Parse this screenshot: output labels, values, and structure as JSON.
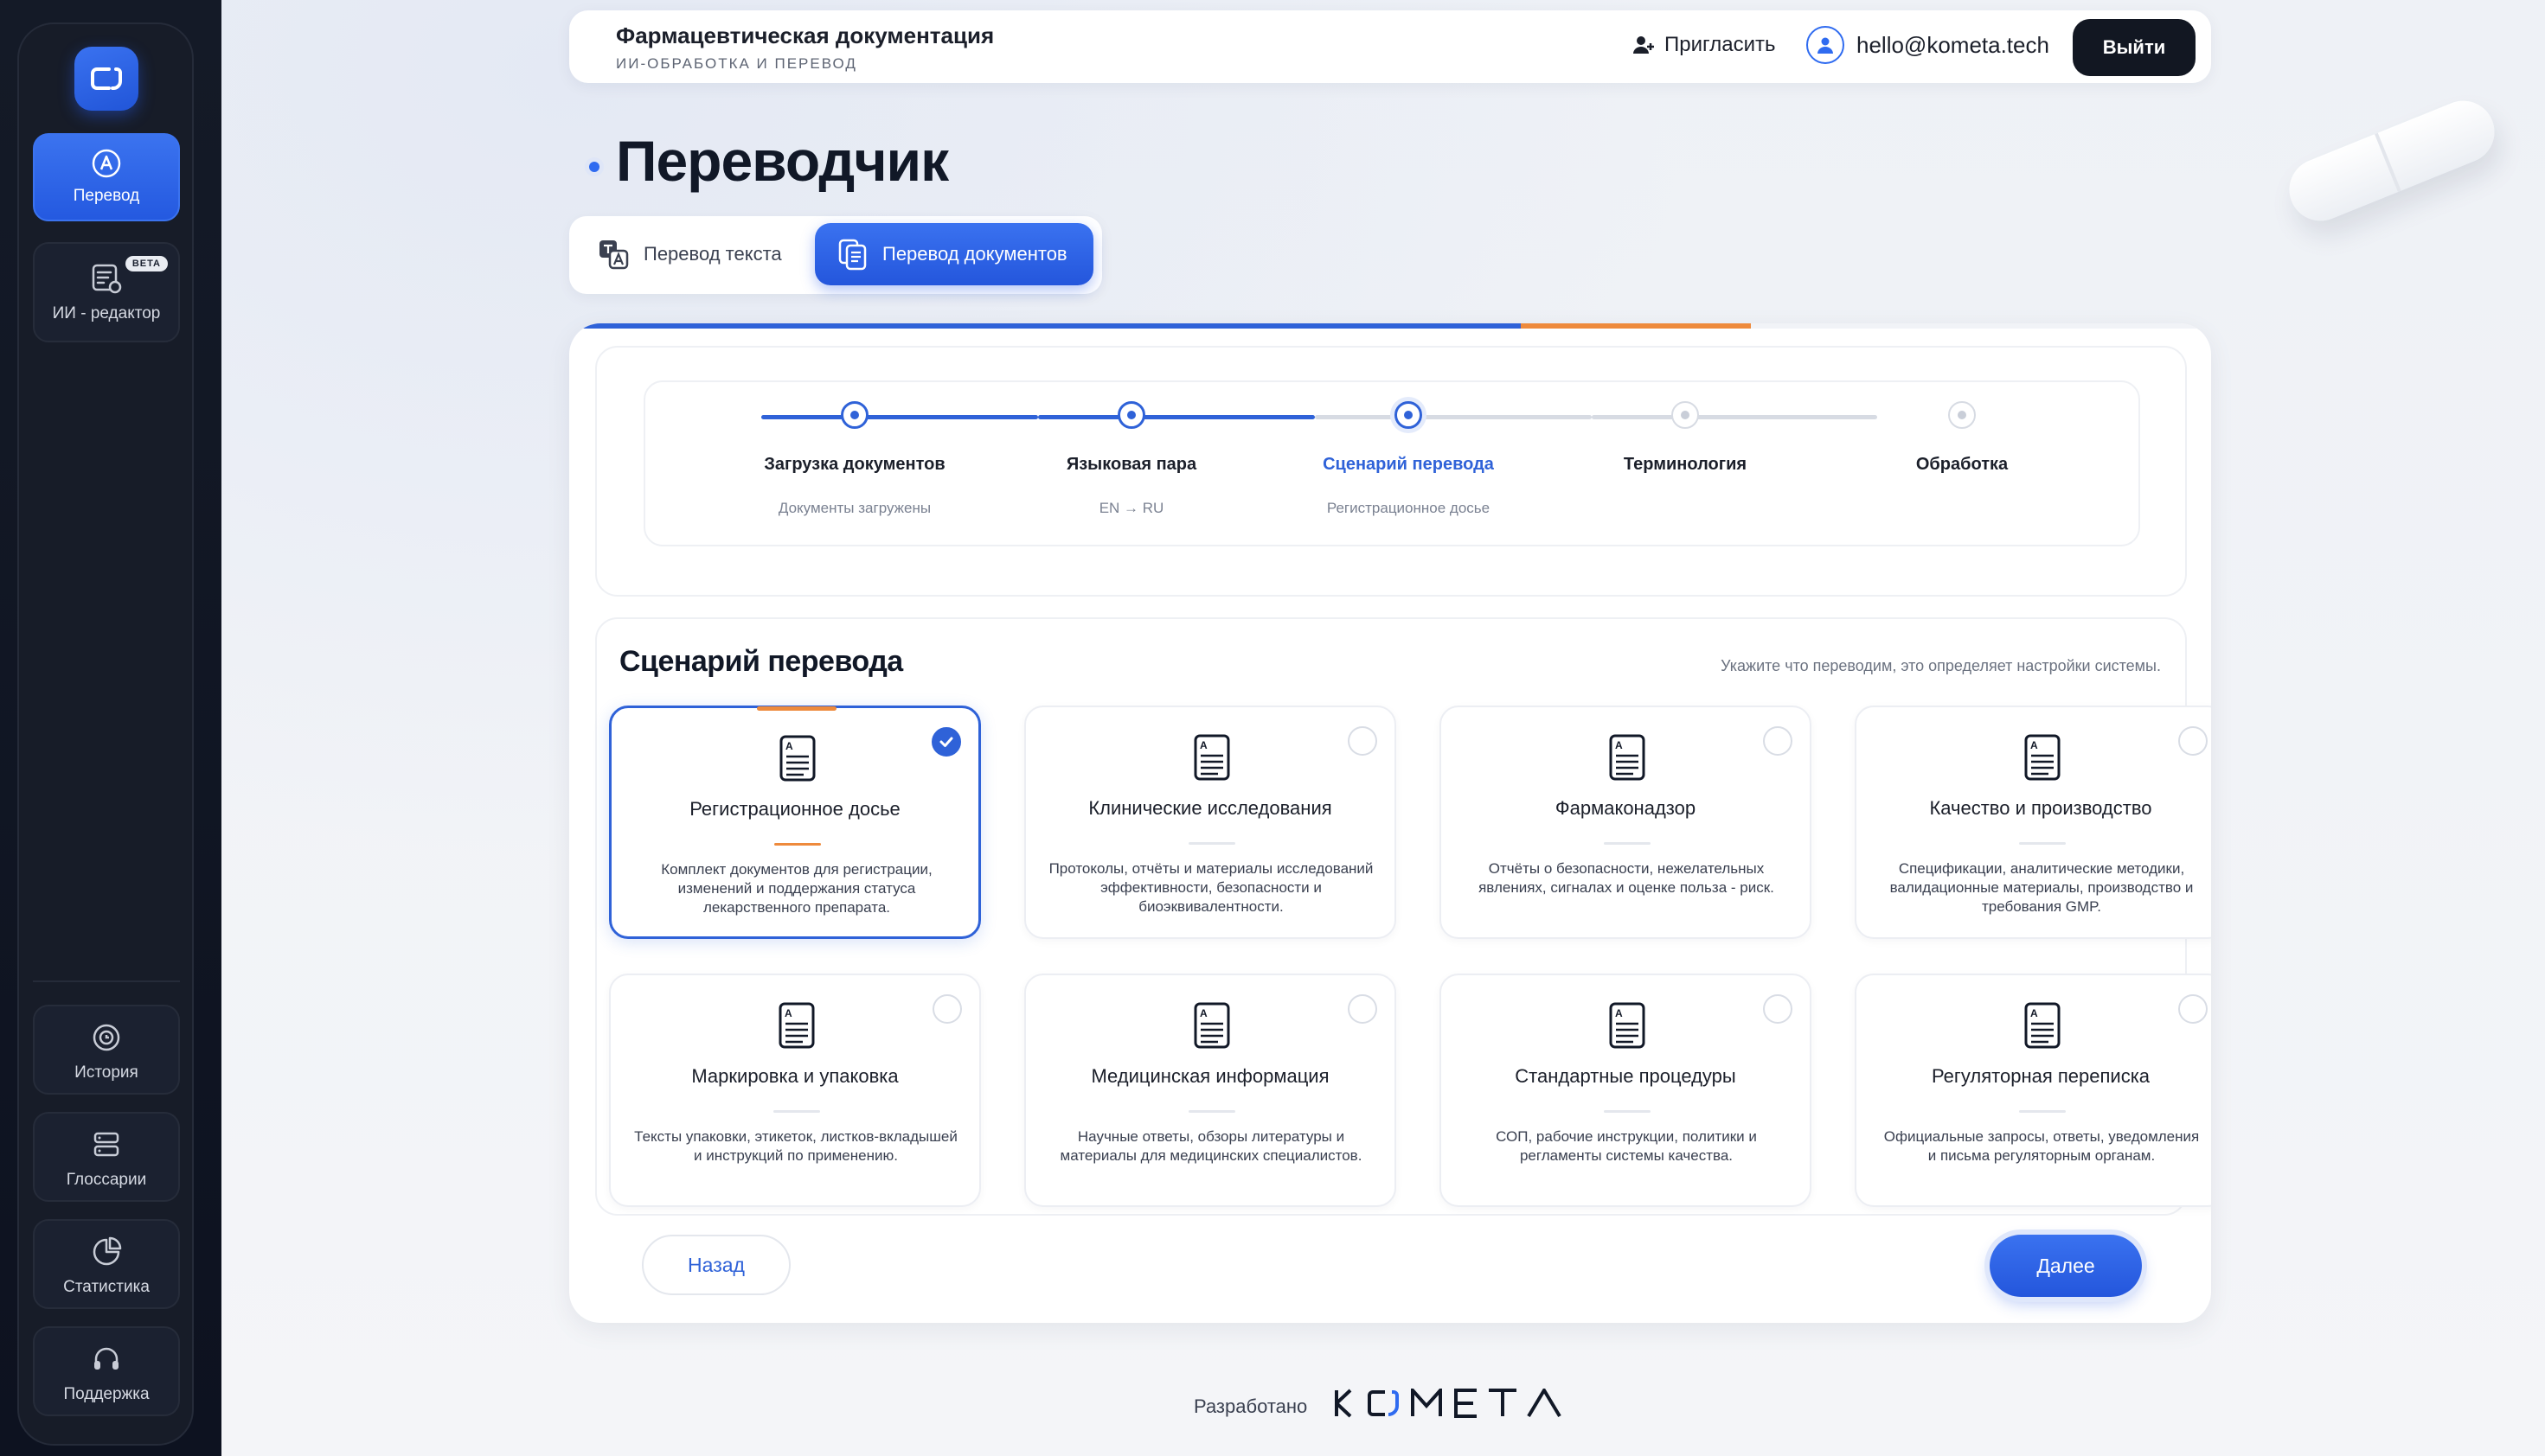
{
  "sidebar": {
    "items": [
      {
        "label": "Перевод",
        "icon": "translate-icon"
      },
      {
        "label": "ИИ - редактор",
        "icon": "ai-editor-icon",
        "badge": "BETA"
      },
      {
        "label": "История",
        "icon": "history-icon"
      },
      {
        "label": "Глоссарии",
        "icon": "glossary-icon"
      },
      {
        "label": "Статистика",
        "icon": "statistics-icon"
      },
      {
        "label": "Поддержка",
        "icon": "support-icon"
      }
    ]
  },
  "header": {
    "title": "Фармацевтическая документация",
    "subtitle": "ИИ-ОБРАБОТКА И ПЕРЕВОД",
    "invite_label": "Пригласить",
    "user_email": "hello@kometa.tech",
    "logout_label": "Выйти"
  },
  "page": {
    "title": "Переводчик"
  },
  "tabs": [
    {
      "label": "Перевод текста",
      "active": false
    },
    {
      "label": "Перевод документов",
      "active": true
    }
  ],
  "progress": {
    "completed_fraction": 0.58,
    "current_fraction": 0.14
  },
  "steps": [
    {
      "name": "Загрузка документов",
      "sub": "Документы загружены",
      "state": "done"
    },
    {
      "name": "Языковая пара",
      "sub": "EN → RU",
      "state": "done"
    },
    {
      "name": "Сценарий перевода",
      "sub": "Регистрационное досье",
      "state": "current"
    },
    {
      "name": "Терминология",
      "sub": "",
      "state": "pending"
    },
    {
      "name": "Обработка",
      "sub": "",
      "state": "pending"
    }
  ],
  "scenario": {
    "heading": "Сценарий перевода",
    "hint": "Укажите что переводим, это определяет настройки системы.",
    "options": [
      {
        "title": "Регистрационное досье",
        "desc": "Комплект документов для регистрации, изменений и поддержания статуса лекарственного препарата.",
        "selected": true
      },
      {
        "title": "Клинические исследования",
        "desc": "Протоколы, отчёты и материалы исследований эффективности, безопасности и биоэквивалентности.",
        "selected": false
      },
      {
        "title": "Фармаконадзор",
        "desc": "Отчёты о безопасности, нежелательных явлениях, сигналах и оценке польза - риск.",
        "selected": false
      },
      {
        "title": "Качество и производство",
        "desc": "Спецификации, аналитические методики, валидационные материалы, производство и требования GMP.",
        "selected": false
      },
      {
        "title": "Маркировка и упаковка",
        "desc": "Тексты упаковки, этикеток, листков-вкладышей и инструкций по применению.",
        "selected": false
      },
      {
        "title": "Медицинская информация",
        "desc": "Научные ответы, обзоры литературы и материалы для медицинских специалистов.",
        "selected": false
      },
      {
        "title": "Стандартные процедуры",
        "desc": "СОП, рабочие инструкции, политики и регламенты системы качества.",
        "selected": false
      },
      {
        "title": "Регуляторная переписка",
        "desc": "Официальные запросы, ответы, уведомления и письма регуляторным органам.",
        "selected": false
      }
    ]
  },
  "actions": {
    "back_label": "Назад",
    "next_label": "Далее"
  },
  "footer": {
    "made_by": "Разработано",
    "brand": "KOMETA"
  },
  "colors": {
    "accent": "#2f62d8",
    "accent_orange": "#ee8a3c",
    "sidebar_bg": "#171c28"
  }
}
